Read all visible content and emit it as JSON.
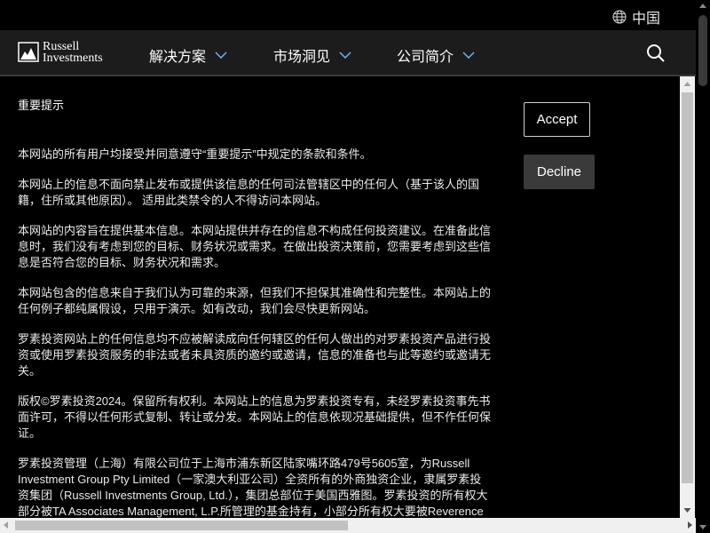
{
  "header": {
    "language": "中国",
    "logo_line1": "Russell",
    "logo_line2": "Investments",
    "nav": [
      {
        "label": "解决方案"
      },
      {
        "label": "市场洞见"
      },
      {
        "label": "公司简介"
      }
    ],
    "icons": {
      "globe": "globe-icon",
      "search": "search-icon",
      "chevron": "chevron-down-icon"
    }
  },
  "notice": {
    "title": "重要提示",
    "paragraphs": [
      "本网站的所有用户均接受并同意遵守“重要提示”中规定的条款和条件。",
      "本网站上的信息不面向禁止发布或提供该信息的任何司法管辖区中的任何人（基于该人的国籍，住所或其他原因）。 适用此类禁令的人不得访问本网站。",
      "本网站的内容旨在提供基本信息。本网站提供并存在的信息不构成任何投资建议。在准备此信息时，我们没有考虑到您的目标、财务状况或需求。在做出投资决策前，您需要考虑到这些信息是否符合您的目标、财务状况和需求。",
      "本网站包含的信息来自于我们认为可靠的来源，但我们不担保其准确性和完整性。本网站上的任何例子都纯属假设，只用于演示。如有改动，我们会尽快更新网站。",
      "罗素投资网站上的任何信息均不应被解读成向任何辖区的任何人做出的对罗素投资产品进行投资或使用罗素投资服务的非法或者未具资质的邀约或邀请，信息的准备也与此等邀约或邀请无关。",
      "版权©罗素投资2024。保留所有权利。本网站上的信息为罗素投资专有，未经罗素投资事先书面许可，不得以任何形式复制、转让或分发。本网站上的信息依现况基础提供，但不作任何保证。",
      "罗素投资管理（上海）有限公司位于上海市浦东新区陆家嘴环路479号5605室，为Russell Investment Group Pty Limited（一家澳大利亚公司）全资所有的外商独资企业，隶属罗素投资集团（Russell Investments Group, Ltd.），集团总部位于美国西雅图。罗素投资的所有权大部分被TA Associates Management, L.P.所管理的基金持有，小部分所有权大要被Reverence"
    ],
    "accept_label": "Accept",
    "decline_label": "Decline"
  }
}
